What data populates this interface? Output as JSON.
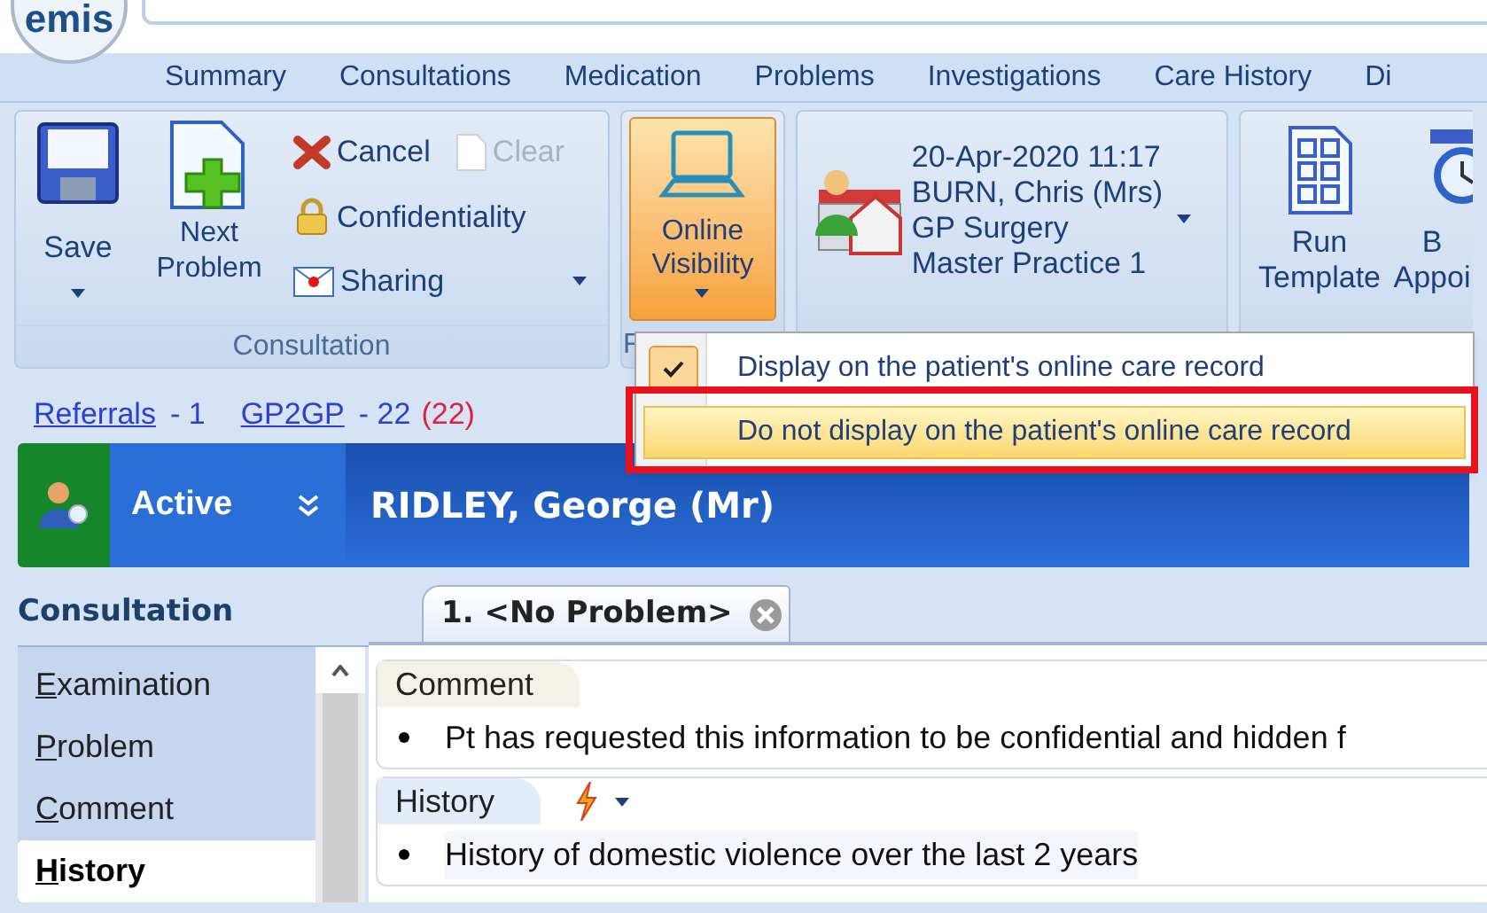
{
  "app": {
    "logo": "emis"
  },
  "tabs": [
    {
      "label": "Summary",
      "selected": false
    },
    {
      "label": "Consultations",
      "selected": false
    },
    {
      "label": "Medication",
      "selected": false
    },
    {
      "label": "Problems",
      "selected": false
    },
    {
      "label": "Investigations",
      "selected": false
    },
    {
      "label": "Care History",
      "selected": false
    },
    {
      "label": "Di",
      "selected": false
    }
  ],
  "ribbon": {
    "consultation_group": {
      "label": "Consultation",
      "save": "Save",
      "next_problem": "Next Problem",
      "cancel": "Cancel",
      "clear": {
        "label": "Clear",
        "disabled": true
      },
      "confidentiality": "Confidentiality",
      "sharing": "Sharing"
    },
    "visibility_group": {
      "label": "F",
      "button": "Online Visibility",
      "pressed": true
    },
    "session": {
      "lines": [
        "20-Apr-2020 11:17",
        "BURN, Chris (Mrs)",
        "GP Surgery",
        "Master Practice 1"
      ]
    },
    "tools": [
      {
        "kind": "template",
        "label": [
          "Run",
          "Template"
        ]
      },
      {
        "kind": "appointment",
        "label": [
          "B",
          "Appoi"
        ]
      }
    ]
  },
  "visibility_menu": {
    "items": [
      {
        "label": "Display on the patient's online care record",
        "checked": true,
        "selected": false,
        "annotated": false
      },
      {
        "label": "Do not display on the patient's online care record",
        "checked": false,
        "selected": true,
        "annotated": true
      }
    ]
  },
  "links": [
    {
      "label": "Referrals",
      "count": "- 1"
    },
    {
      "label": "GP2GP",
      "count": "- 22",
      "alert": "(22)"
    }
  ],
  "patient_bar": {
    "status": "Active",
    "name": "RIDLEY, George (Mr)"
  },
  "consultation_panel": {
    "title": "Consultation",
    "items": [
      {
        "label": "Examination",
        "selected": false
      },
      {
        "label": "Problem",
        "selected": false
      },
      {
        "label": "Comment",
        "selected": false
      },
      {
        "label": "History",
        "selected": true
      }
    ]
  },
  "problem_tab": {
    "label": "1. <No Problem>"
  },
  "sections": [
    {
      "kind": "comment",
      "title": "Comment",
      "entries": [
        "Pt has requested this information to be confidential and hidden f"
      ]
    },
    {
      "kind": "history",
      "title": "History",
      "entries": [
        "History of domestic violence over the last 2 years"
      ]
    }
  ]
}
